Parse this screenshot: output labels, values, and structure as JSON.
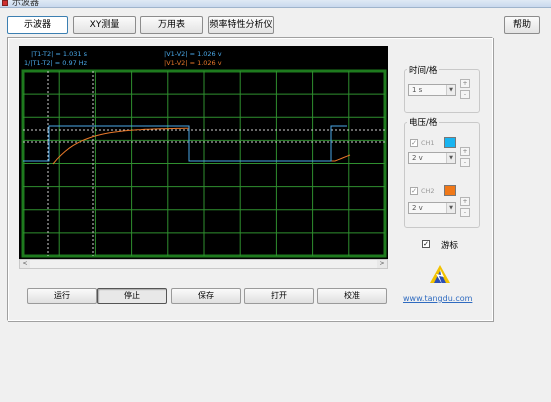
{
  "window": {
    "title": "示波器"
  },
  "tabs": [
    {
      "label": "示波器",
      "active": true
    },
    {
      "label": "XY测量",
      "active": false
    },
    {
      "label": "万用表",
      "active": false
    },
    {
      "label": "频率特性分析仪",
      "active": false
    }
  ],
  "help_label": "帮助",
  "scope": {
    "readouts": {
      "t_diff": "|T1-T2| = 1.031 s",
      "freq": "1/|T1-T2| = 0.97 Hz",
      "v_diff_ch1": "|V1-V2| = 1.026 v",
      "v_diff_ch2": "|V1-V2| = 1.026 v"
    },
    "colors": {
      "grid": "#2f8f2f",
      "border": "#1e7a1e",
      "ch1": "#4aa8e8",
      "ch2": "#e8782a",
      "cursor": "#cfcfcf"
    }
  },
  "controls": {
    "time_group_label": "时间/格",
    "time_value": "1 s",
    "volt_group_label": "电压/格",
    "ch1": {
      "label": "CH1",
      "value": "2 v",
      "checked": true,
      "color": "#19b4f0"
    },
    "ch2": {
      "label": "CH2",
      "value": "2 v",
      "checked": true,
      "color": "#f07818"
    },
    "cursor_label": "游标",
    "cursor_checked": true,
    "spin_up": "+",
    "spin_down": "-",
    "checkmark": "✓"
  },
  "buttons": {
    "run": "运行",
    "stop": "停止",
    "save": "保存",
    "open": "打开",
    "calibrate": "校准"
  },
  "scroll": {
    "left": "<",
    "right": ">"
  },
  "website": "www.tangdu.com"
}
